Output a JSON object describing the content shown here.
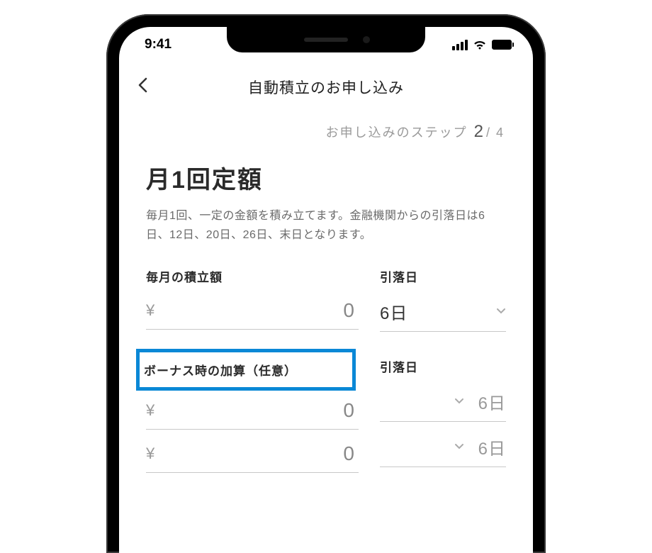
{
  "statusbar": {
    "time": "9:41"
  },
  "nav": {
    "title": "自動積立のお申し込み"
  },
  "step": {
    "label": "お申し込みのステップ",
    "current": "2",
    "total": "4",
    "sep": "/"
  },
  "main": {
    "title": "月1回定額",
    "description": "毎月1回、一定の金額を積み立てます。金融機関からの引落日は6日、12日、20日、26日、末日となります。"
  },
  "monthly": {
    "amount_label": "毎月の積立額",
    "currency": "¥",
    "amount": "0",
    "date_label": "引落日",
    "date": "6日"
  },
  "bonus": {
    "label": "ボーナス時の加算（任意）",
    "date_label": "引落日",
    "rows": [
      {
        "currency": "¥",
        "amount": "0",
        "date": "6日"
      },
      {
        "currency": "¥",
        "amount": "0",
        "date": "6日"
      }
    ]
  }
}
